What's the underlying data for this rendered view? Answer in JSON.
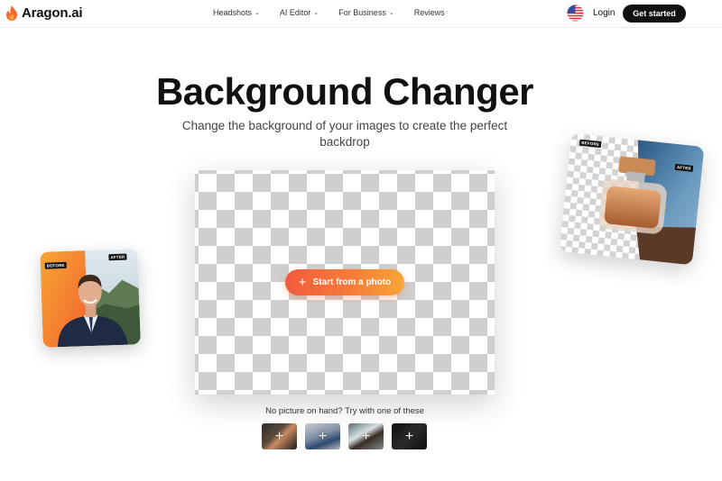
{
  "nav": {
    "brand": "Aragon.ai",
    "menu": [
      {
        "label": "Headshots",
        "has_dropdown": true
      },
      {
        "label": "AI Editor",
        "has_dropdown": true
      },
      {
        "label": "For Business",
        "has_dropdown": true
      },
      {
        "label": "Reviews",
        "has_dropdown": false
      }
    ],
    "locale_icon": "us-flag-icon",
    "login_label": "Login",
    "cta_label": "Get started"
  },
  "hero": {
    "title": "Background Changer",
    "subtitle": "Change the background of your images to create the perfect backdrop"
  },
  "editor": {
    "start_label": "Start from a photo",
    "hint": "No picture on hand? Try with one of these",
    "samples": [
      {
        "name": "sample-man-glasses"
      },
      {
        "name": "sample-denim-jacket"
      },
      {
        "name": "sample-woman-portrait"
      },
      {
        "name": "sample-shoe"
      }
    ]
  },
  "examples": {
    "left_card": {
      "before_tag": "BEFORE",
      "after_tag": "AFTER"
    },
    "right_card": {
      "before_tag": "BEFORE",
      "after_tag": "AFTER"
    }
  },
  "colors": {
    "brand_flame": "#f26a2e",
    "cta_bg": "#111111",
    "button_gradient_start": "#f35a3c",
    "button_gradient_end": "#f7a634"
  }
}
